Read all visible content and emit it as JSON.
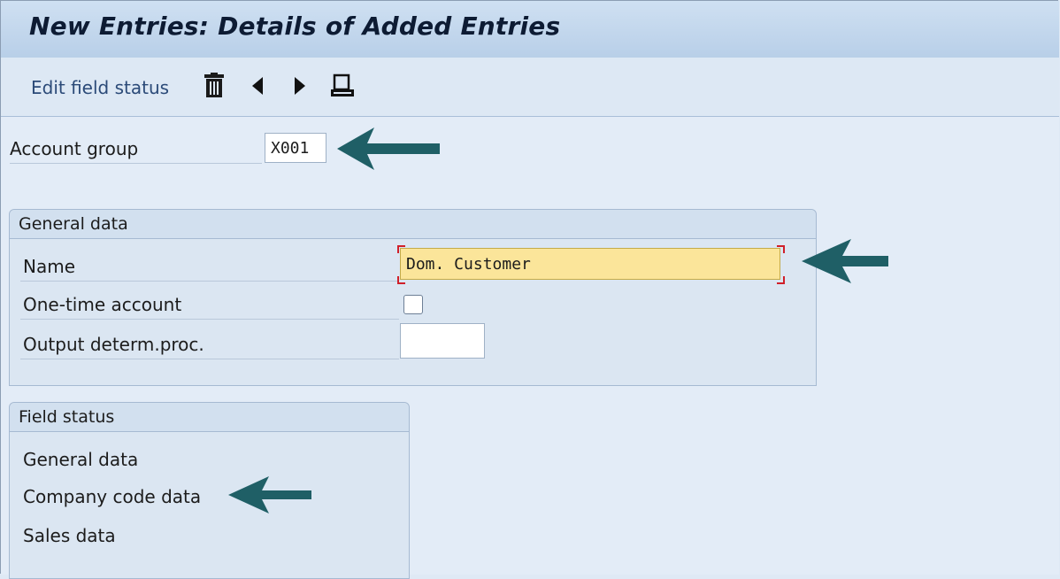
{
  "window": {
    "title": "New Entries: Details of Added Entries"
  },
  "toolbar": {
    "edit_field_status_label": "Edit field status",
    "icons": [
      "trash-icon",
      "previous-entry-icon",
      "next-entry-icon",
      "print-icon"
    ]
  },
  "account_group": {
    "label": "Account group",
    "value": "X001"
  },
  "general_data": {
    "title": "General data",
    "name_label": "Name",
    "name_value": "Dom. Customer",
    "one_time_label": "One-time account",
    "one_time_checked": false,
    "output_label": "Output determ.proc.",
    "output_value": ""
  },
  "field_status": {
    "title": "Field status",
    "items": [
      "General data",
      "Company code data",
      "Sales data"
    ]
  },
  "colors": {
    "arrow": "#1f5f66",
    "title_bar": "#c3d7ee",
    "highlight_field": "#fbe59a",
    "focus_bracket": "#d0202a"
  }
}
